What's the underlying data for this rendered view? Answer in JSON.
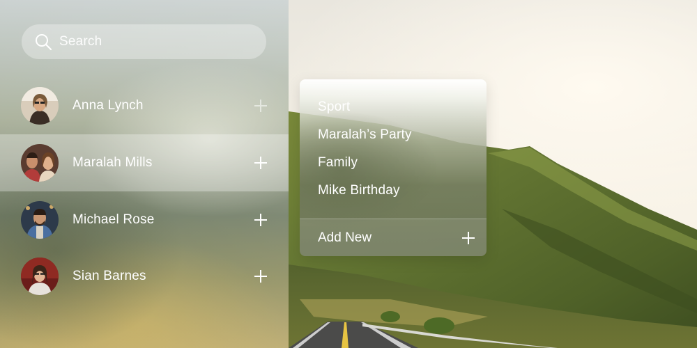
{
  "search": {
    "placeholder": "Search",
    "icon": "search-icon"
  },
  "contacts": [
    {
      "name": "Anna Lynch",
      "selected": false,
      "action_icon": "plus-icon"
    },
    {
      "name": "Maralah Mills",
      "selected": true,
      "action_icon": "plus-icon"
    },
    {
      "name": "Michael Rose",
      "selected": false,
      "action_icon": "plus-icon"
    },
    {
      "name": "Sian Barnes",
      "selected": false,
      "action_icon": "plus-icon"
    }
  ],
  "menu": {
    "items": [
      "Sport",
      "Maralah’s Party",
      "Family",
      "Mike Birthday"
    ],
    "add_new_label": "Add New",
    "add_icon": "plus-icon"
  },
  "colors": {
    "text": "#ffffff",
    "selected_row": "rgba(255,255,255,0.30)"
  }
}
